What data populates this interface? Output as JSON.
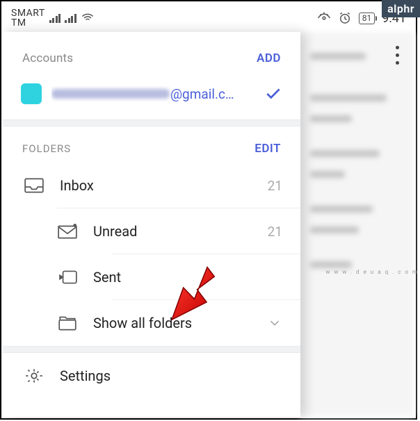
{
  "status": {
    "carrier": "SMART\nTM",
    "battery": "81",
    "time": "9:41"
  },
  "drawer": {
    "accounts": {
      "label": "Accounts",
      "add": "ADD",
      "list": [
        {
          "email_suffix": "@gmail.c…",
          "selected": true
        }
      ]
    },
    "folders": {
      "label": "FOLDERS",
      "edit": "EDIT",
      "items": [
        {
          "icon": "inbox-icon",
          "label": "Inbox",
          "count": "21"
        },
        {
          "icon": "unread-icon",
          "label": "Unread",
          "count": "21"
        },
        {
          "icon": "sent-icon",
          "label": "Sent",
          "count": ""
        },
        {
          "icon": "all-folders-icon",
          "label": "Show all folders",
          "expand": true
        }
      ]
    },
    "settings": {
      "label": "Settings"
    }
  },
  "branding": {
    "alphr": "alphr",
    "watermark": "www.deuaq.com"
  }
}
